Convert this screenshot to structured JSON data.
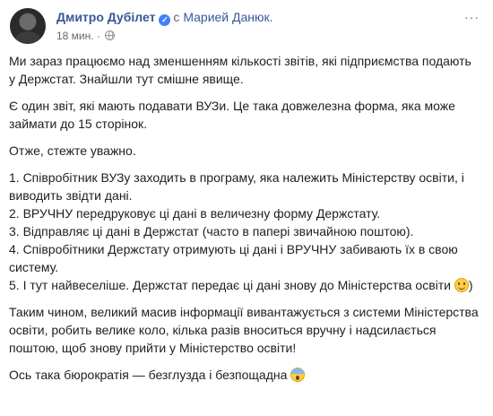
{
  "post": {
    "author": "Дмитро Дубілет",
    "with_text": "с",
    "tagged": "Марией Данюк.",
    "timestamp": "18 мин.",
    "more_label": "···",
    "icons": {
      "verified": "verified-badge-icon",
      "privacy": "globe-icon",
      "more": "more-options-icon"
    },
    "paragraphs": [
      "Ми зараз працюємо над зменшенням кількості звітів, які підприємства подають у Держстат. Знайшли тут смішне явище.",
      "Є один звіт, які мають подавати ВУЗи. Це така довжелезна форма, яка може займати до 15 сторінок.",
      "Отже, стежте уважно."
    ],
    "list": [
      "1. Співробітник ВУЗу заходить в програму, яка належить Міністерству освіти, і виводить звідти дані.",
      "2. ВРУЧНУ передруковує ці дані в величезну форму Держстату.",
      "3. Відправляє ці дані в Держстат (часто в папері звичайною поштою).",
      "4. Співробітники Держстату отримують ці дані і ВРУЧНУ забивають їх в свою систему.",
      "5. І тут найвеселіше. Держстат передає ці дані знову до Міністерства освіти"
    ],
    "conclusion": "Таким чином, великий масив інформації вивантажується з системи Міністерства освіти, робить велике коло, кілька разів вноситься вручну і надсилається поштою, щоб знову прийти у Міністерство освіти!",
    "closing": "Ось така бюрократія — безглузда і безпощадна"
  }
}
